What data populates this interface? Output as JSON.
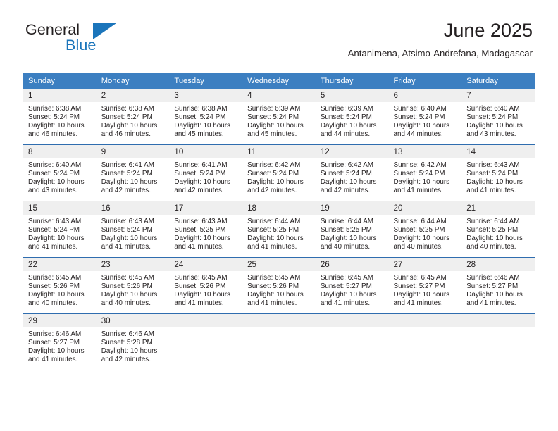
{
  "brand": {
    "name_top": "General",
    "name_bottom": "Blue",
    "triangle_color": "#1b75bb"
  },
  "header": {
    "title": "June 2025",
    "subtitle": "Antanimena, Atsimo-Andrefana, Madagascar"
  },
  "theme": {
    "header_bg": "#3c7fc1",
    "row_divider": "#2f6daf",
    "daynum_bg": "#efefef",
    "text": "#231f20"
  },
  "calendar": {
    "weekday_headers": [
      "Sunday",
      "Monday",
      "Tuesday",
      "Wednesday",
      "Thursday",
      "Friday",
      "Saturday"
    ],
    "weeks": [
      [
        {
          "day": "1",
          "sunrise": "Sunrise: 6:38 AM",
          "sunset": "Sunset: 5:24 PM",
          "daylight_line1": "Daylight: 10 hours",
          "daylight_line2": "and 46 minutes."
        },
        {
          "day": "2",
          "sunrise": "Sunrise: 6:38 AM",
          "sunset": "Sunset: 5:24 PM",
          "daylight_line1": "Daylight: 10 hours",
          "daylight_line2": "and 46 minutes."
        },
        {
          "day": "3",
          "sunrise": "Sunrise: 6:38 AM",
          "sunset": "Sunset: 5:24 PM",
          "daylight_line1": "Daylight: 10 hours",
          "daylight_line2": "and 45 minutes."
        },
        {
          "day": "4",
          "sunrise": "Sunrise: 6:39 AM",
          "sunset": "Sunset: 5:24 PM",
          "daylight_line1": "Daylight: 10 hours",
          "daylight_line2": "and 45 minutes."
        },
        {
          "day": "5",
          "sunrise": "Sunrise: 6:39 AM",
          "sunset": "Sunset: 5:24 PM",
          "daylight_line1": "Daylight: 10 hours",
          "daylight_line2": "and 44 minutes."
        },
        {
          "day": "6",
          "sunrise": "Sunrise: 6:40 AM",
          "sunset": "Sunset: 5:24 PM",
          "daylight_line1": "Daylight: 10 hours",
          "daylight_line2": "and 44 minutes."
        },
        {
          "day": "7",
          "sunrise": "Sunrise: 6:40 AM",
          "sunset": "Sunset: 5:24 PM",
          "daylight_line1": "Daylight: 10 hours",
          "daylight_line2": "and 43 minutes."
        }
      ],
      [
        {
          "day": "8",
          "sunrise": "Sunrise: 6:40 AM",
          "sunset": "Sunset: 5:24 PM",
          "daylight_line1": "Daylight: 10 hours",
          "daylight_line2": "and 43 minutes."
        },
        {
          "day": "9",
          "sunrise": "Sunrise: 6:41 AM",
          "sunset": "Sunset: 5:24 PM",
          "daylight_line1": "Daylight: 10 hours",
          "daylight_line2": "and 42 minutes."
        },
        {
          "day": "10",
          "sunrise": "Sunrise: 6:41 AM",
          "sunset": "Sunset: 5:24 PM",
          "daylight_line1": "Daylight: 10 hours",
          "daylight_line2": "and 42 minutes."
        },
        {
          "day": "11",
          "sunrise": "Sunrise: 6:42 AM",
          "sunset": "Sunset: 5:24 PM",
          "daylight_line1": "Daylight: 10 hours",
          "daylight_line2": "and 42 minutes."
        },
        {
          "day": "12",
          "sunrise": "Sunrise: 6:42 AM",
          "sunset": "Sunset: 5:24 PM",
          "daylight_line1": "Daylight: 10 hours",
          "daylight_line2": "and 42 minutes."
        },
        {
          "day": "13",
          "sunrise": "Sunrise: 6:42 AM",
          "sunset": "Sunset: 5:24 PM",
          "daylight_line1": "Daylight: 10 hours",
          "daylight_line2": "and 41 minutes."
        },
        {
          "day": "14",
          "sunrise": "Sunrise: 6:43 AM",
          "sunset": "Sunset: 5:24 PM",
          "daylight_line1": "Daylight: 10 hours",
          "daylight_line2": "and 41 minutes."
        }
      ],
      [
        {
          "day": "15",
          "sunrise": "Sunrise: 6:43 AM",
          "sunset": "Sunset: 5:24 PM",
          "daylight_line1": "Daylight: 10 hours",
          "daylight_line2": "and 41 minutes."
        },
        {
          "day": "16",
          "sunrise": "Sunrise: 6:43 AM",
          "sunset": "Sunset: 5:24 PM",
          "daylight_line1": "Daylight: 10 hours",
          "daylight_line2": "and 41 minutes."
        },
        {
          "day": "17",
          "sunrise": "Sunrise: 6:43 AM",
          "sunset": "Sunset: 5:25 PM",
          "daylight_line1": "Daylight: 10 hours",
          "daylight_line2": "and 41 minutes."
        },
        {
          "day": "18",
          "sunrise": "Sunrise: 6:44 AM",
          "sunset": "Sunset: 5:25 PM",
          "daylight_line1": "Daylight: 10 hours",
          "daylight_line2": "and 41 minutes."
        },
        {
          "day": "19",
          "sunrise": "Sunrise: 6:44 AM",
          "sunset": "Sunset: 5:25 PM",
          "daylight_line1": "Daylight: 10 hours",
          "daylight_line2": "and 40 minutes."
        },
        {
          "day": "20",
          "sunrise": "Sunrise: 6:44 AM",
          "sunset": "Sunset: 5:25 PM",
          "daylight_line1": "Daylight: 10 hours",
          "daylight_line2": "and 40 minutes."
        },
        {
          "day": "21",
          "sunrise": "Sunrise: 6:44 AM",
          "sunset": "Sunset: 5:25 PM",
          "daylight_line1": "Daylight: 10 hours",
          "daylight_line2": "and 40 minutes."
        }
      ],
      [
        {
          "day": "22",
          "sunrise": "Sunrise: 6:45 AM",
          "sunset": "Sunset: 5:26 PM",
          "daylight_line1": "Daylight: 10 hours",
          "daylight_line2": "and 40 minutes."
        },
        {
          "day": "23",
          "sunrise": "Sunrise: 6:45 AM",
          "sunset": "Sunset: 5:26 PM",
          "daylight_line1": "Daylight: 10 hours",
          "daylight_line2": "and 40 minutes."
        },
        {
          "day": "24",
          "sunrise": "Sunrise: 6:45 AM",
          "sunset": "Sunset: 5:26 PM",
          "daylight_line1": "Daylight: 10 hours",
          "daylight_line2": "and 41 minutes."
        },
        {
          "day": "25",
          "sunrise": "Sunrise: 6:45 AM",
          "sunset": "Sunset: 5:26 PM",
          "daylight_line1": "Daylight: 10 hours",
          "daylight_line2": "and 41 minutes."
        },
        {
          "day": "26",
          "sunrise": "Sunrise: 6:45 AM",
          "sunset": "Sunset: 5:27 PM",
          "daylight_line1": "Daylight: 10 hours",
          "daylight_line2": "and 41 minutes."
        },
        {
          "day": "27",
          "sunrise": "Sunrise: 6:45 AM",
          "sunset": "Sunset: 5:27 PM",
          "daylight_line1": "Daylight: 10 hours",
          "daylight_line2": "and 41 minutes."
        },
        {
          "day": "28",
          "sunrise": "Sunrise: 6:46 AM",
          "sunset": "Sunset: 5:27 PM",
          "daylight_line1": "Daylight: 10 hours",
          "daylight_line2": "and 41 minutes."
        }
      ],
      [
        {
          "day": "29",
          "sunrise": "Sunrise: 6:46 AM",
          "sunset": "Sunset: 5:27 PM",
          "daylight_line1": "Daylight: 10 hours",
          "daylight_line2": "and 41 minutes."
        },
        {
          "day": "30",
          "sunrise": "Sunrise: 6:46 AM",
          "sunset": "Sunset: 5:28 PM",
          "daylight_line1": "Daylight: 10 hours",
          "daylight_line2": "and 42 minutes."
        },
        {
          "day": "",
          "sunrise": "",
          "sunset": "",
          "daylight_line1": "",
          "daylight_line2": ""
        },
        {
          "day": "",
          "sunrise": "",
          "sunset": "",
          "daylight_line1": "",
          "daylight_line2": ""
        },
        {
          "day": "",
          "sunrise": "",
          "sunset": "",
          "daylight_line1": "",
          "daylight_line2": ""
        },
        {
          "day": "",
          "sunrise": "",
          "sunset": "",
          "daylight_line1": "",
          "daylight_line2": ""
        },
        {
          "day": "",
          "sunrise": "",
          "sunset": "",
          "daylight_line1": "",
          "daylight_line2": ""
        }
      ]
    ]
  }
}
